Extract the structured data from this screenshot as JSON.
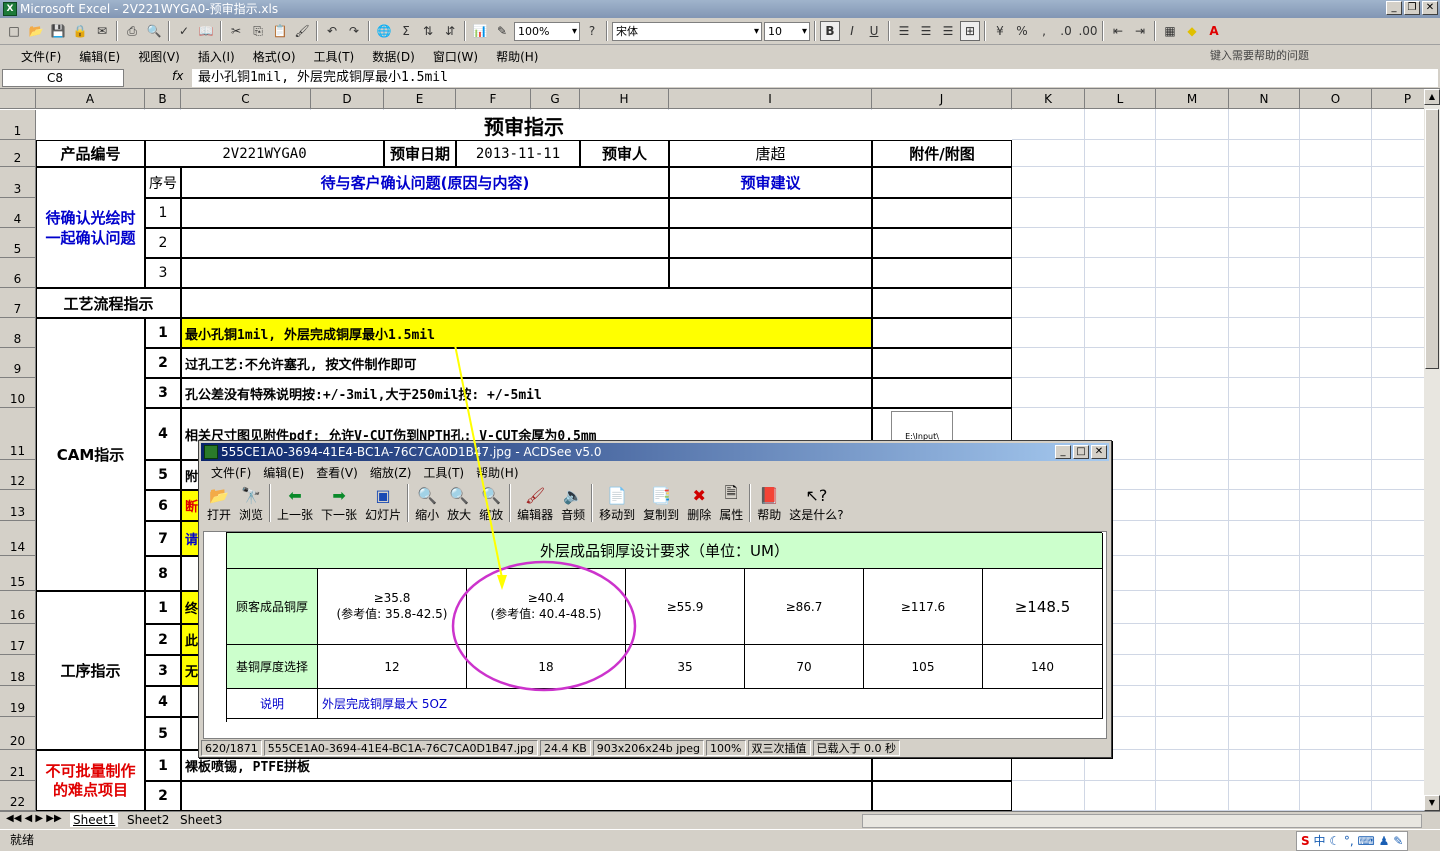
{
  "excel": {
    "title": "Microsoft Excel - 2V221WYGA0-预审指示.xls",
    "zoom": "100%",
    "font_name": "宋体",
    "font_size": "10",
    "menu": [
      "文件(F)",
      "编辑(E)",
      "视图(V)",
      "插入(I)",
      "格式(O)",
      "工具(T)",
      "数据(D)",
      "窗口(W)",
      "帮助(H)"
    ],
    "help_placeholder": "键入需要帮助的问题",
    "name_box": "C8",
    "fx": "fx",
    "formula": "最小孔铜1mil, 外层完成铜厚最小1.5mil",
    "columns": [
      "A",
      "B",
      "C",
      "D",
      "E",
      "F",
      "G",
      "H",
      "I",
      "J",
      "K",
      "L",
      "M",
      "N",
      "O",
      "P"
    ],
    "rows": [
      "1",
      "2",
      "3",
      "4",
      "5",
      "6",
      "7",
      "8",
      "9",
      "10",
      "11",
      "12",
      "13",
      "14",
      "15",
      "16",
      "17",
      "18",
      "19",
      "20",
      "21",
      "22"
    ],
    "sheets": [
      "Sheet1",
      "Sheet2",
      "Sheet3"
    ],
    "status": "就绪",
    "ime": "中"
  },
  "sheet": {
    "title": "预审指示",
    "product_no_label": "产品编号",
    "product_no": "2V221WYGA0",
    "review_date_label": "预审日期",
    "review_date": "2013-11-11",
    "reviewer_label": "预审人",
    "reviewer": "唐超",
    "attachment_label": "附件/附图",
    "confirm_section": "待确认光绘时\n一起确认问题",
    "seq_label": "序号",
    "question_header": "待与客户确认问题(原因与内容)",
    "suggestion_header": "预审建议",
    "confirm_seq": [
      "1",
      "2",
      "3"
    ],
    "process_label": "工艺流程指示",
    "cam_label": "CAM指示",
    "cam_seq": [
      "1",
      "2",
      "3",
      "4",
      "5",
      "6",
      "7",
      "8"
    ],
    "cam_items": [
      "最小孔铜1mil, 外层完成铜厚最小1.5mil",
      "过孔工艺:不允许塞孔, 按文件制作即可",
      "孔公差没有特殊说明按:+/-3mil,大于250mil按: +/-5mil",
      "相关尺寸图见附件pdf; 允许V-CUT伤到NPTH孔; V-CUT余厚为0.5mm",
      "附",
      "断",
      "请",
      ""
    ],
    "attachment_file": "E:\\Input\\",
    "process2_label": "工序指示",
    "process_seq": [
      "1",
      "2",
      "3",
      "4",
      "5"
    ],
    "process_items": [
      "终",
      "此",
      "无",
      "",
      ""
    ],
    "hard_label": "不可批量制作\n的难点项目",
    "hard_seq": [
      "1",
      "2"
    ],
    "hard_items": [
      "裸板喷锡, PTFE拼板",
      ""
    ]
  },
  "acdsee": {
    "title": "555CE1A0-3694-41E4-BC1A-76C7CA0D1B47.jpg - ACDSee v5.0",
    "menu": [
      "文件(F)",
      "编辑(E)",
      "查看(V)",
      "缩放(Z)",
      "工具(T)",
      "帮助(H)"
    ],
    "tools": [
      "打开",
      "浏览",
      "上一张",
      "下一张",
      "幻灯片",
      "缩小",
      "放大",
      "缩放",
      "编辑器",
      "音频",
      "移动到",
      "复制到",
      "删除",
      "属性",
      "帮助",
      "这是什么?"
    ],
    "image_title": "外层成品铜厚设计要求（单位：UM）",
    "row1_label": "顾客成品铜厚",
    "row1_values": [
      "≥35.8\n(参考值: 35.8-42.5)",
      "≥40.4\n(参考值: 40.4-48.5)",
      "≥55.9",
      "≥86.7",
      "≥117.6",
      "≥148.5"
    ],
    "row2_label": "基铜厚度选择",
    "row2_values": [
      "12",
      "18",
      "35",
      "70",
      "105",
      "140"
    ],
    "row3_label": "说明",
    "row3_value": "外层完成铜厚最大 5OZ",
    "status": [
      "620/1871",
      "555CE1A0-3694-41E4-BC1A-76C7CA0D1B47.jpg",
      "24.4 KB",
      "903x206x24b jpeg",
      "100%",
      "双三次插值",
      "已载入于 0.0 秒"
    ]
  },
  "colors": {
    "highlight": "#ffff00",
    "label_blue": "#0000cc",
    "label_red": "#e00000",
    "image_green": "#ccffcc",
    "circle": "#cc33cc"
  }
}
